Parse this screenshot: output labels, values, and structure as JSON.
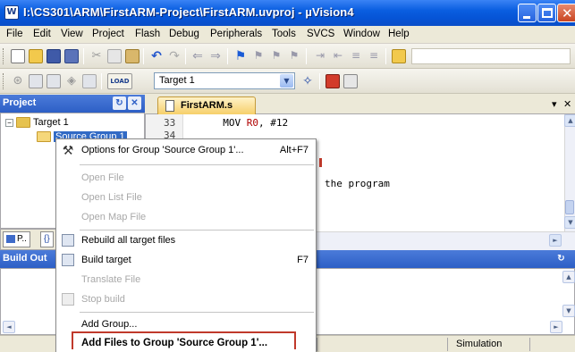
{
  "window": {
    "title": "I:\\CS301\\ARM\\FirstARM-Project\\FirstARM.uvproj - µVision4"
  },
  "menu": [
    "File",
    "Edit",
    "View",
    "Project",
    "Flash",
    "Debug",
    "Peripherals",
    "Tools",
    "SVCS",
    "Window",
    "Help"
  ],
  "toolbar": {
    "target_select": "Target 1",
    "load_label": "LOAD"
  },
  "project_pane": {
    "title": "Project",
    "tree": {
      "target": "Target 1",
      "group": "Source Group 1"
    },
    "tabs": [
      "P..",
      "{}"
    ]
  },
  "editor": {
    "file_tab": "FirstARM.s",
    "lines": [
      {
        "num": "33",
        "code": "        MOV ",
        "reg": "R0",
        "rest": ", #12"
      },
      {
        "num": "34",
        "code": "",
        "reg": "",
        "rest": ""
      }
    ],
    "comment_fragment": "the program"
  },
  "build_output": {
    "title": "Build Output",
    "title_visible": "Build Out"
  },
  "status": {
    "mode": "Simulation"
  },
  "context_menu": {
    "items": [
      {
        "label": "Options for Group 'Source Group 1'...",
        "shortcut": "Alt+F7",
        "enabled": true,
        "icon": "options-wand-icon"
      },
      {
        "label": "Open File",
        "shortcut": "",
        "enabled": false,
        "icon": ""
      },
      {
        "label": "Open List File",
        "shortcut": "",
        "enabled": false,
        "icon": ""
      },
      {
        "label": "Open Map File",
        "shortcut": "",
        "enabled": false,
        "icon": ""
      },
      {
        "label": "Rebuild all target files",
        "shortcut": "",
        "enabled": true,
        "icon": "rebuild-icon"
      },
      {
        "label": "Build target",
        "shortcut": "F7",
        "enabled": true,
        "icon": "build-icon"
      },
      {
        "label": "Translate File",
        "shortcut": "",
        "enabled": false,
        "icon": ""
      },
      {
        "label": "Stop build",
        "shortcut": "",
        "enabled": false,
        "icon": "stop-build-icon"
      },
      {
        "label": "Add Group...",
        "shortcut": "",
        "enabled": true,
        "icon": ""
      },
      {
        "label": "Add Files to Group 'Source Group 1'...",
        "shortcut": "",
        "enabled": true,
        "icon": ""
      }
    ]
  },
  "colors": {
    "titlebar": "#0a5ee0",
    "pane_header": "#2d5fc6",
    "selection": "#316ac5",
    "highlight_box": "#c0392b"
  }
}
